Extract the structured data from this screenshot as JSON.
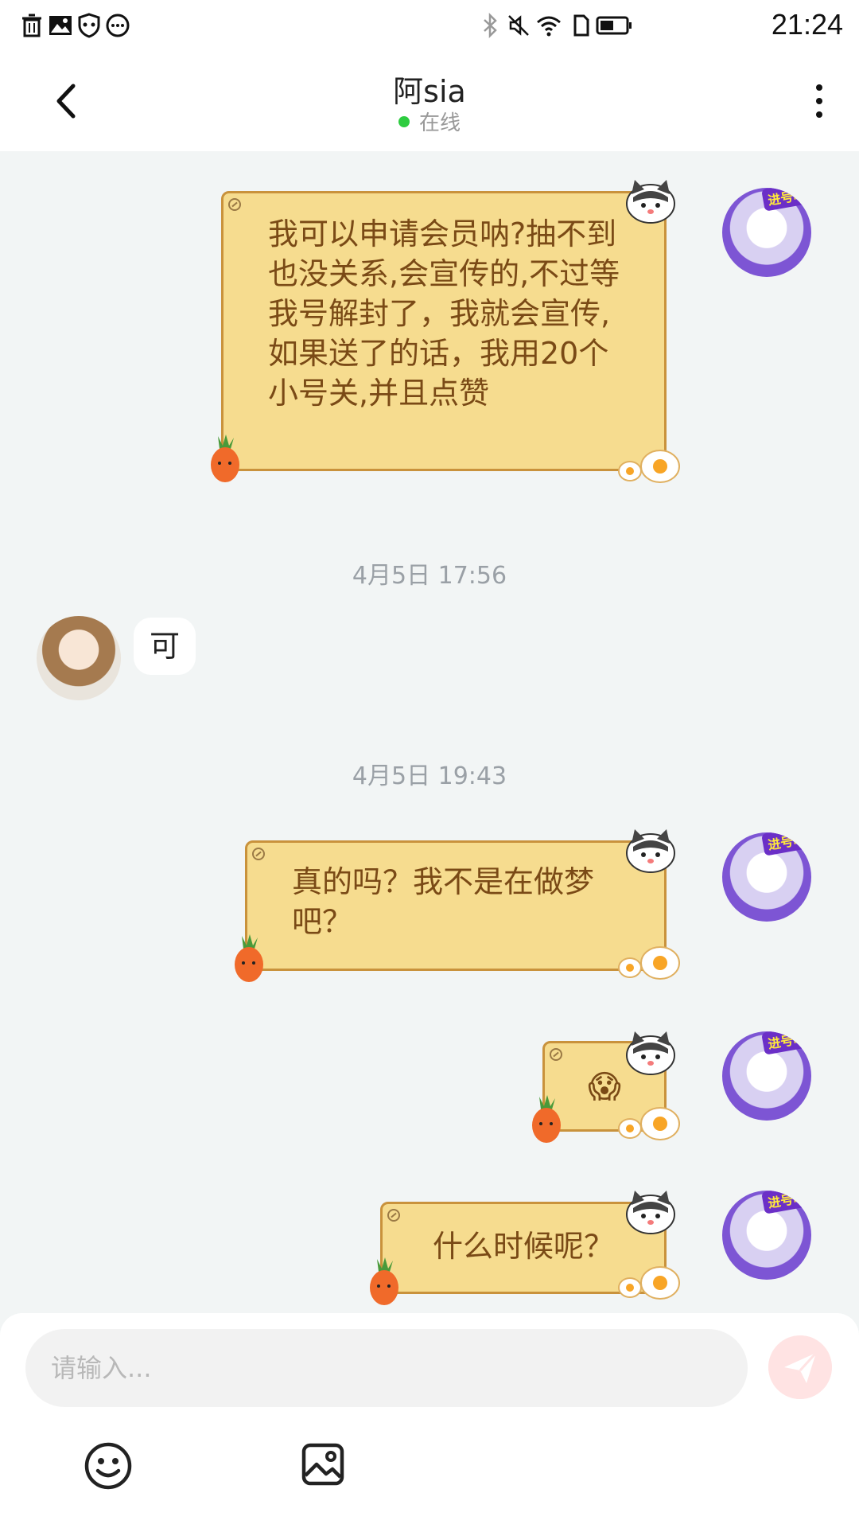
{
  "status_bar": {
    "time": "21:24",
    "left_icons": [
      "trash-icon",
      "image-icon",
      "shield-icon",
      "more-circle-icon"
    ],
    "right_icons": [
      "bluetooth-icon",
      "mute-icon",
      "wifi-icon",
      "sim-icon",
      "battery-icon"
    ]
  },
  "header": {
    "title": "阿sia",
    "status": "在线",
    "status_color": "#2ecc40"
  },
  "messages": [
    {
      "side": "right",
      "type": "text",
      "text": " 我可以申请会员呐?抽不到也没关系,会宣传的,不过等我号解封了，我就会宣传,如果送了的话，我用20个小号关,并且点赞"
    },
    {
      "type": "timestamp",
      "text": "4月5日 17:56"
    },
    {
      "side": "left",
      "type": "text",
      "text": "可"
    },
    {
      "type": "timestamp",
      "text": "4月5日 19:43"
    },
    {
      "side": "right",
      "type": "text",
      "text": "真的吗？我不是在做梦吧？"
    },
    {
      "side": "right",
      "type": "emoji",
      "text": "😱"
    },
    {
      "side": "right",
      "type": "text",
      "text": "什么时候呢？"
    }
  ],
  "avatar_right": {
    "badge": "进号吧!"
  },
  "input": {
    "placeholder": "请输入..."
  },
  "toolbar_icons": [
    "emoji-icon",
    "image-icon"
  ],
  "colors": {
    "bubble_fill": "#f6dc8f",
    "bubble_border": "#c9923c",
    "bubble_text": "#7a4a16",
    "send_button": "#ffe3e3"
  }
}
